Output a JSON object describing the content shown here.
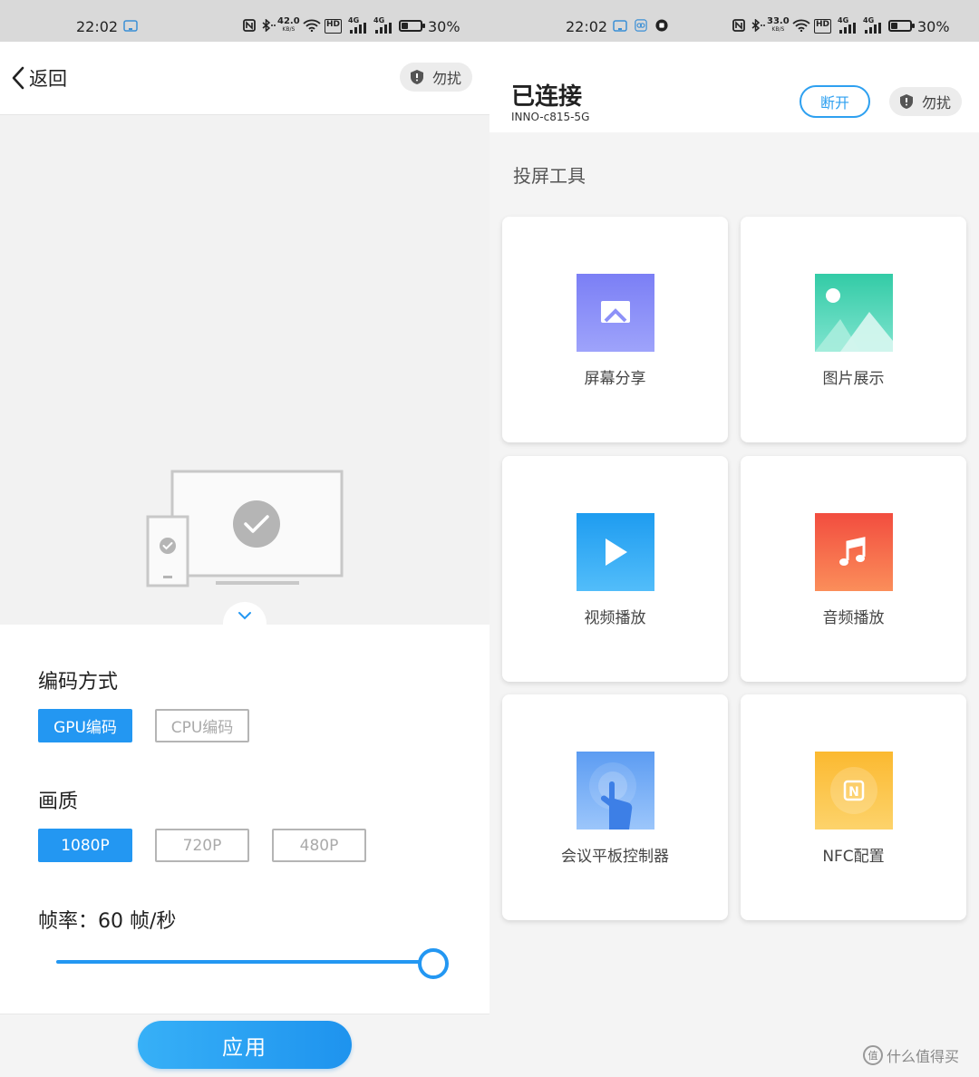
{
  "left": {
    "status": {
      "time": "22:02",
      "speed_value": "42.0",
      "speed_unit": "KB/S",
      "hd": "HD",
      "net1": "4G",
      "net2": "4G",
      "battery": "30%"
    },
    "header": {
      "back_label": "返回",
      "dnd_label": "勿扰"
    },
    "encoding": {
      "title": "编码方式",
      "options": [
        "GPU编码",
        "CPU编码"
      ],
      "selected": "GPU编码"
    },
    "quality": {
      "title": "画质",
      "options": [
        "1080P",
        "720P",
        "480P"
      ],
      "selected": "1080P"
    },
    "framerate": {
      "label": "帧率：60 帧/秒",
      "value": 60,
      "max": 60
    },
    "apply_label": "应用"
  },
  "right": {
    "status": {
      "time": "22:02",
      "speed_value": "33.0",
      "speed_unit": "KB/S",
      "hd": "HD",
      "net1": "4G",
      "net2": "4G",
      "battery": "30%"
    },
    "header": {
      "title": "已连接",
      "ssid": "INNO-c815-5G",
      "disconnect_label": "断开",
      "dnd_label": "勿扰"
    },
    "tools_title": "投屏工具",
    "tiles": [
      {
        "label": "屏幕分享",
        "icon": "screen-share-icon"
      },
      {
        "label": "图片展示",
        "icon": "picture-icon"
      },
      {
        "label": "视频播放",
        "icon": "video-play-icon"
      },
      {
        "label": "音频播放",
        "icon": "music-note-icon"
      },
      {
        "label": "会议平板控制器",
        "icon": "touch-hand-icon"
      },
      {
        "label": "NFC配置",
        "icon": "nfc-icon"
      }
    ],
    "nfc_glyph": "N",
    "watermark": {
      "glyph": "值",
      "text": "什么值得买"
    }
  },
  "colors": {
    "accent": "#2397f2",
    "disconnect": "#2ea0f0"
  }
}
